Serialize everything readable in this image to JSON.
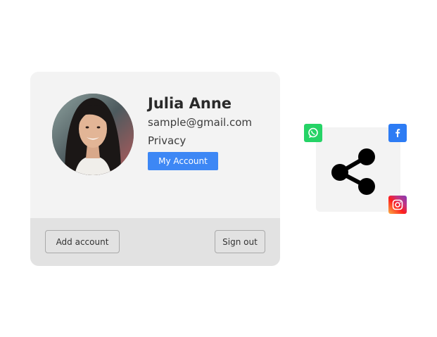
{
  "profile": {
    "name": "Julia Anne",
    "email": "sample@gmail.com",
    "privacy_label": "Privacy",
    "my_account_label": "My Account",
    "add_account_label": "Add account",
    "sign_out_label": "Sign out"
  },
  "share": {
    "icon": "share-icon",
    "badges": [
      "whatsapp-icon",
      "facebook-icon",
      "instagram-icon"
    ]
  },
  "colors": {
    "accent": "#3d87f5",
    "whatsapp": "#25d366",
    "facebook": "#2d7cf4"
  }
}
